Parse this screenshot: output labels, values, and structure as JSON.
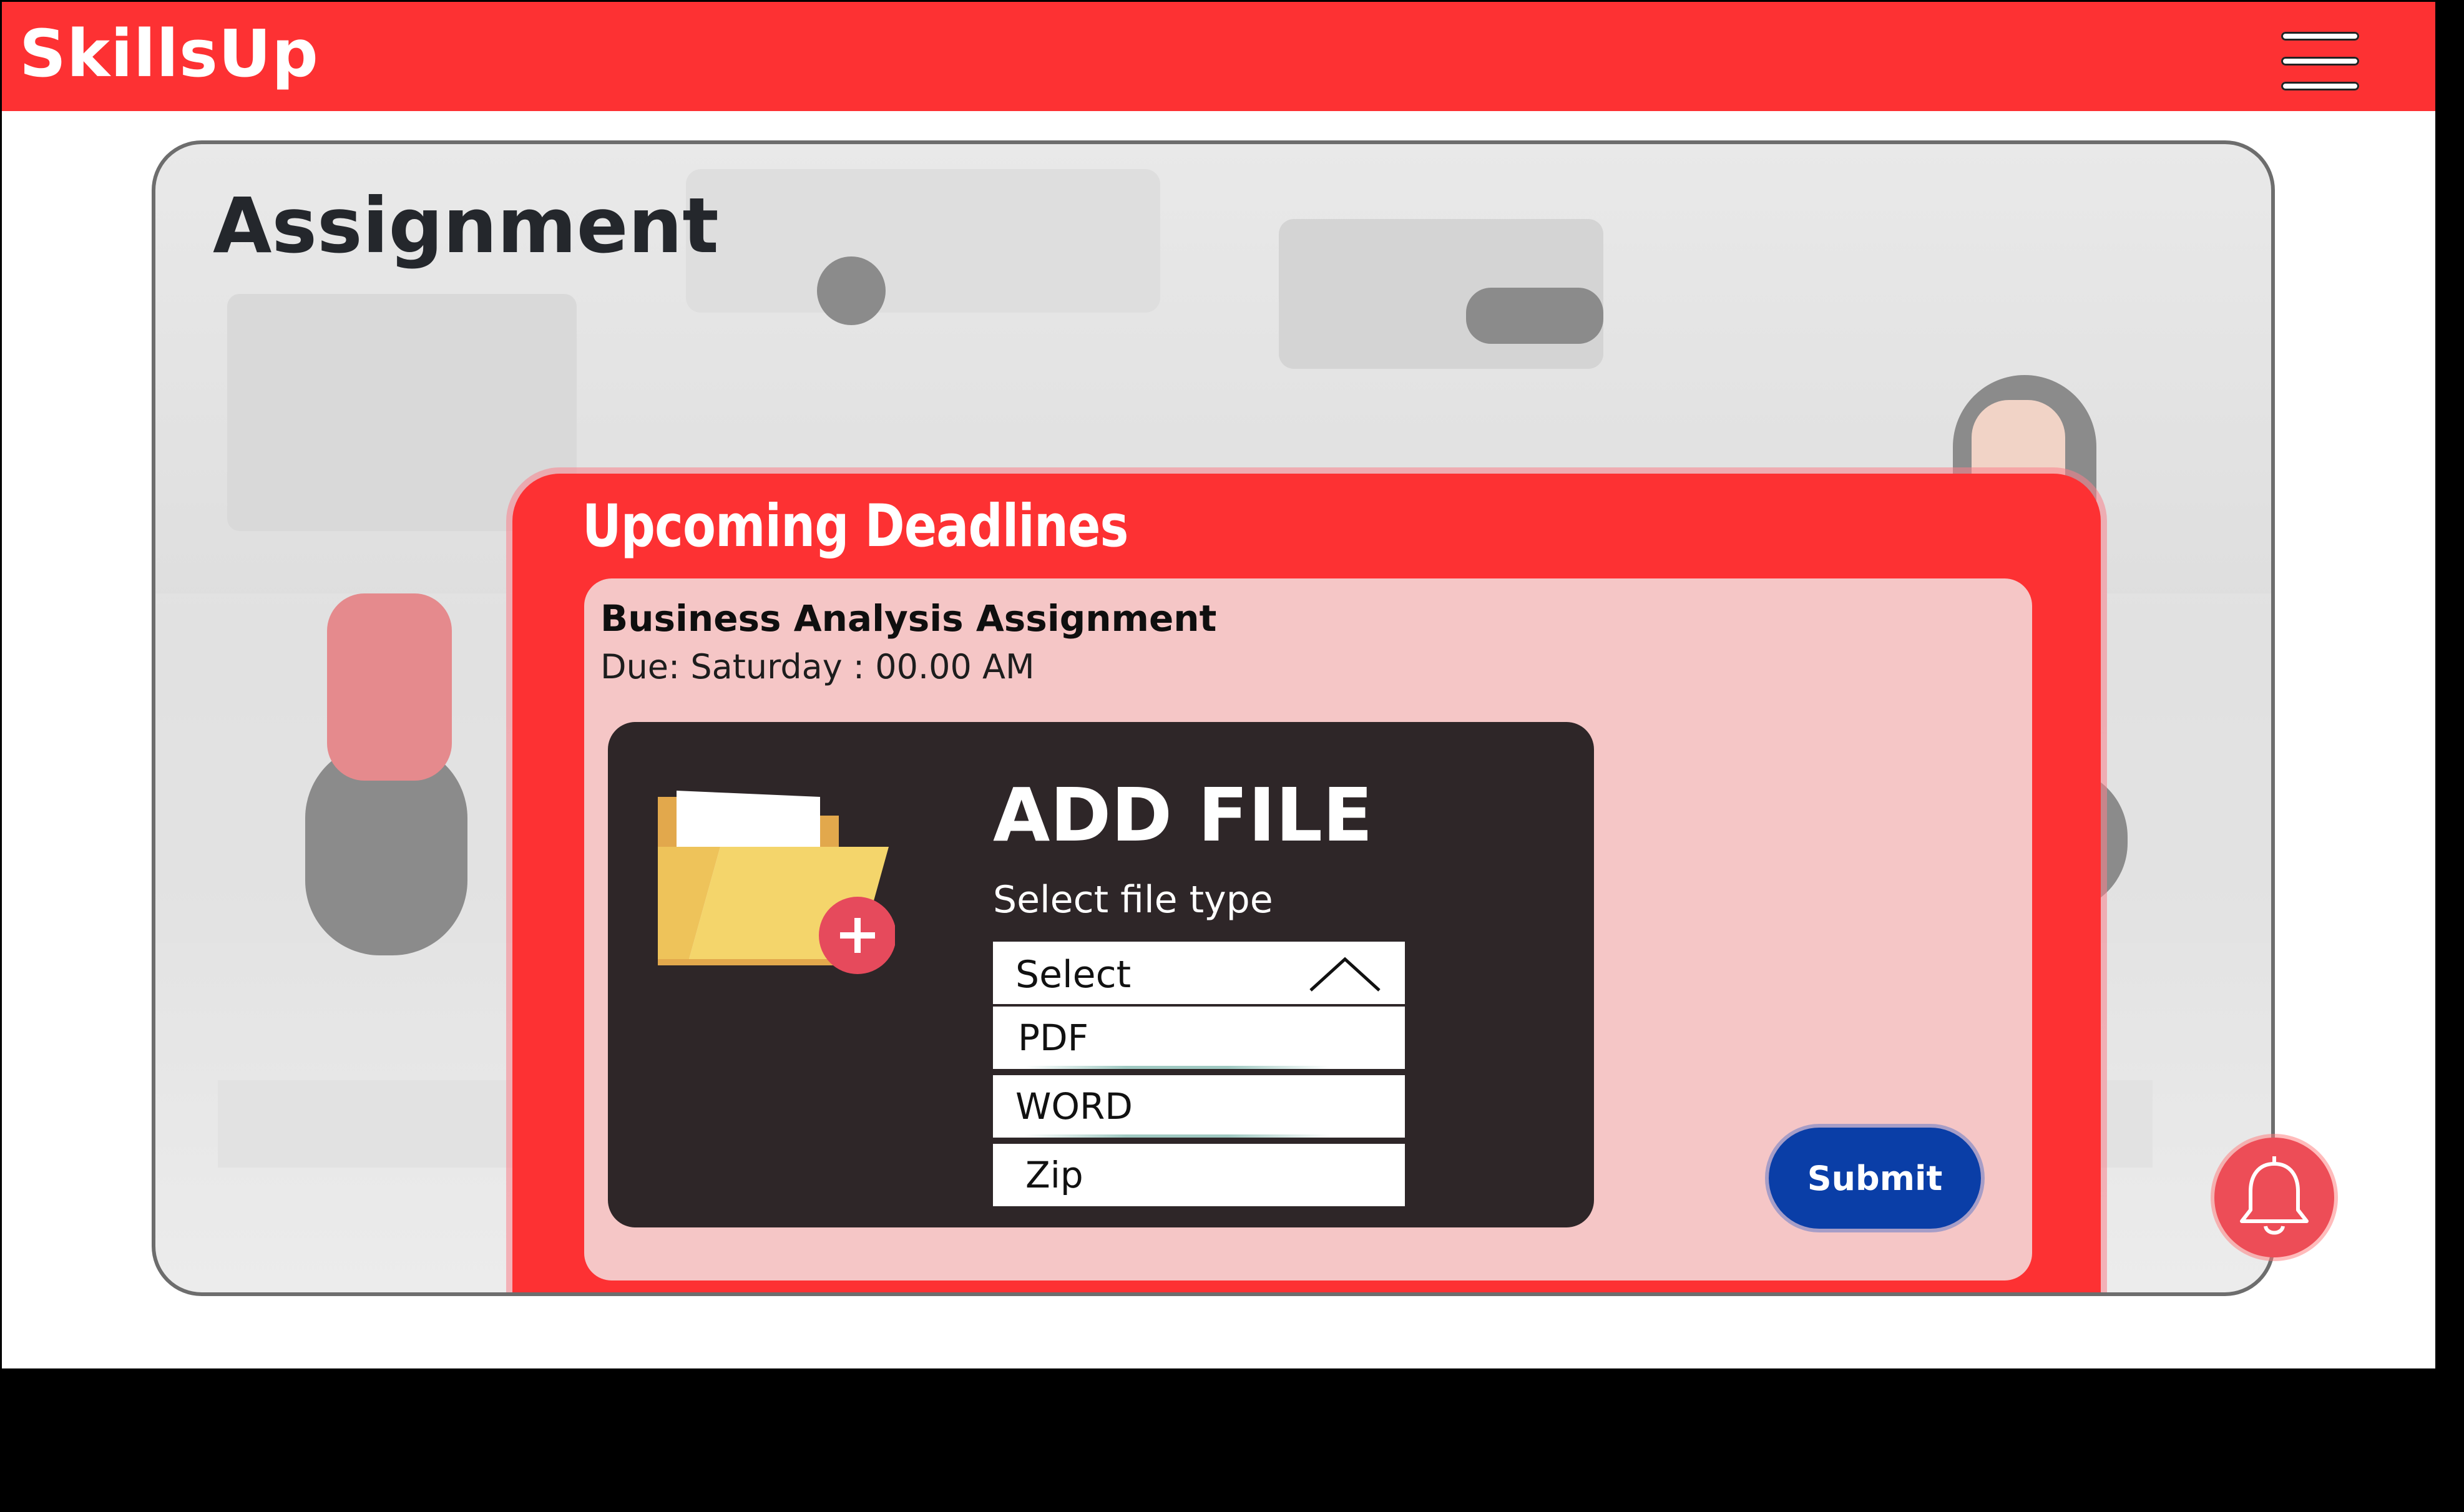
{
  "header": {
    "brand": "SkillsUp",
    "menu_icon": "hamburger-menu-icon",
    "accent_color": "#fd3133"
  },
  "page": {
    "title": "Assignment"
  },
  "deadlines": {
    "heading": "Upcoming Deadlines",
    "assignment_name": "Business Analysis Assignment",
    "due": "Due: Saturday : 00.00 AM"
  },
  "upload": {
    "title": "ADD FILE",
    "file_type_label": "Select file type",
    "folder_icon": "folder-add-icon",
    "select": {
      "value": "Select",
      "expanded": true,
      "options": [
        "PDF",
        "WORD",
        "Zip"
      ]
    }
  },
  "actions": {
    "submit_label": "Submit",
    "submit_color": "#0a3ea7"
  },
  "notifications": {
    "icon": "bell-icon"
  }
}
